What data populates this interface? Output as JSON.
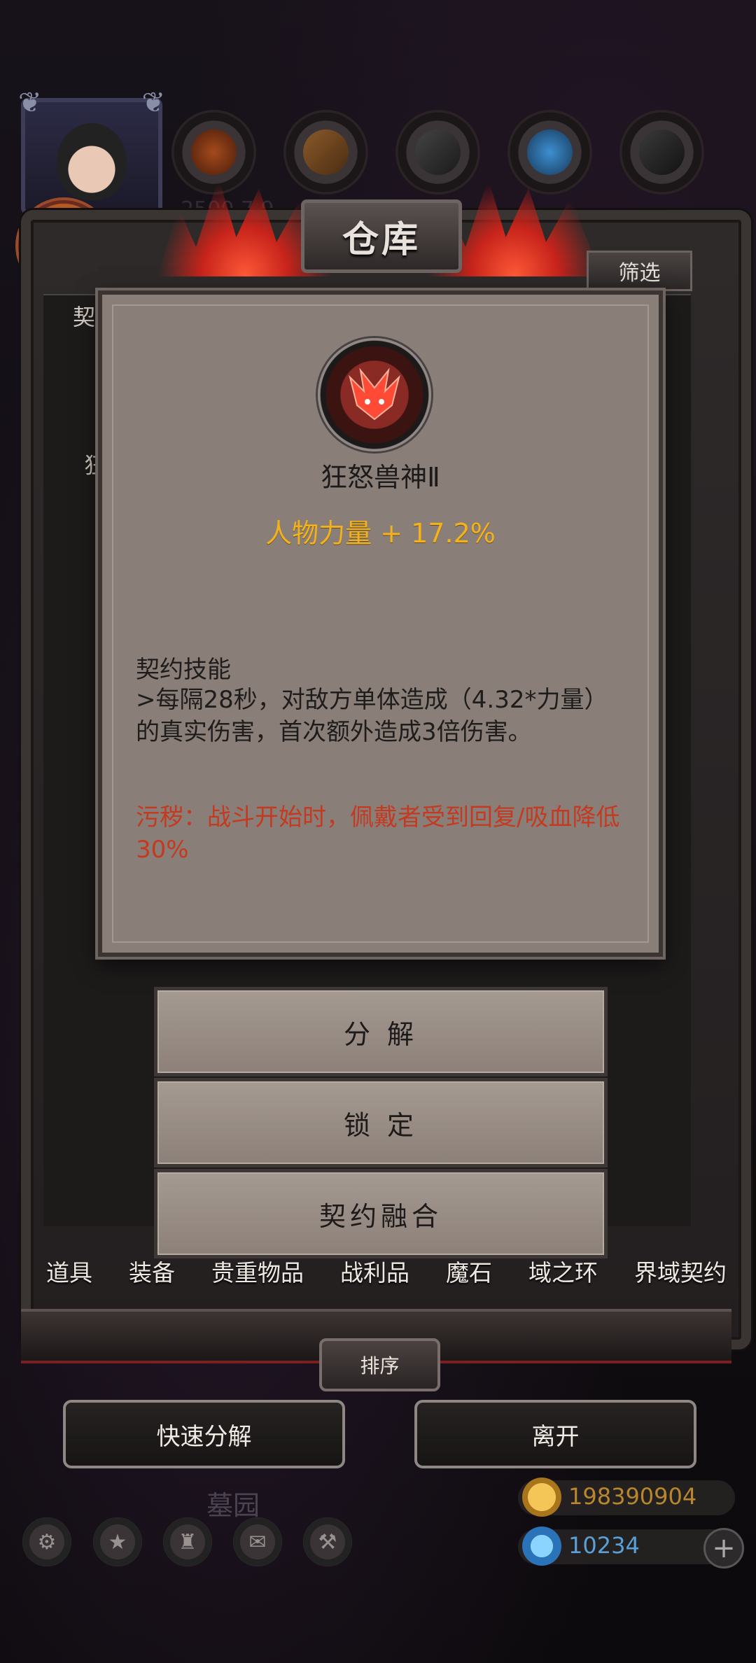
{
  "window": {
    "title": "仓库",
    "filter_label": "筛选"
  },
  "left_tab_hint": "契",
  "left_row_hint": "狂",
  "top_ghost_text": "2500 7 9",
  "item_popup": {
    "name": "狂怒兽神Ⅱ",
    "stat": "人物力量 + 17.2%",
    "skill_title": "契约技能",
    "skill_desc": ">每隔28秒，对敌方单体造成（4.32*力量）的真实伤害，首次额外造成3倍伤害。",
    "curse": "污秽：战斗开始时，佩戴者受到回复/吸血降低30%",
    "stat_color": "#f2b11f",
    "curse_color": "#c43a20"
  },
  "actions": {
    "decompose": "分 解",
    "lock": "锁 定",
    "fusion": "契约融合"
  },
  "categories": [
    "道具",
    "装备",
    "贵重物品",
    "战利品",
    "魔石",
    "域之环",
    "界域契约"
  ],
  "sort_label": "排序",
  "bottom_buttons": {
    "quick_decompose": "快速分解",
    "leave": "离开"
  },
  "location_ghost": "墓园",
  "currency": {
    "gold": "198390904",
    "gems": "10234"
  }
}
